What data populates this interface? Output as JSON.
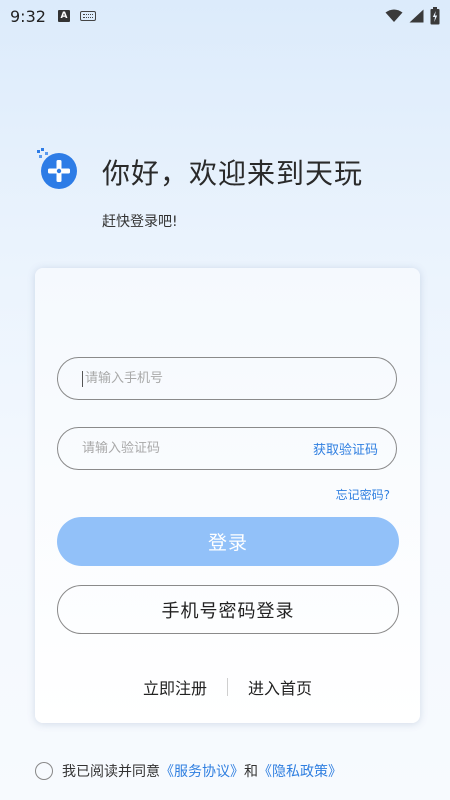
{
  "status_bar": {
    "time": "9:32",
    "ime_badge": "A",
    "icons": [
      "keyboard-icon",
      "wifi-icon",
      "signal-icon",
      "battery-charging-icon"
    ]
  },
  "brand": {
    "logo_icon": "gamepad-logo-icon",
    "title": "你好，欢迎来到天玩",
    "subtitle": "赶快登录吧!"
  },
  "form": {
    "phone_placeholder": "请输入手机号",
    "code_placeholder": "请输入验证码",
    "get_code_label": "获取验证码",
    "forgot_label": "忘记密码?",
    "login_label": "登录",
    "password_login_label": "手机号密码登录",
    "register_label": "立即注册",
    "home_label": "进入首页"
  },
  "agreement": {
    "prefix": "我已阅读并同意",
    "service_link": "《服务协议》",
    "conjunction": "和",
    "privacy_link": "《隐私政策》"
  },
  "colors": {
    "accent": "#2f7fe0",
    "login_button": "#92c1f9",
    "logo_blue": "#2d7ce6"
  }
}
